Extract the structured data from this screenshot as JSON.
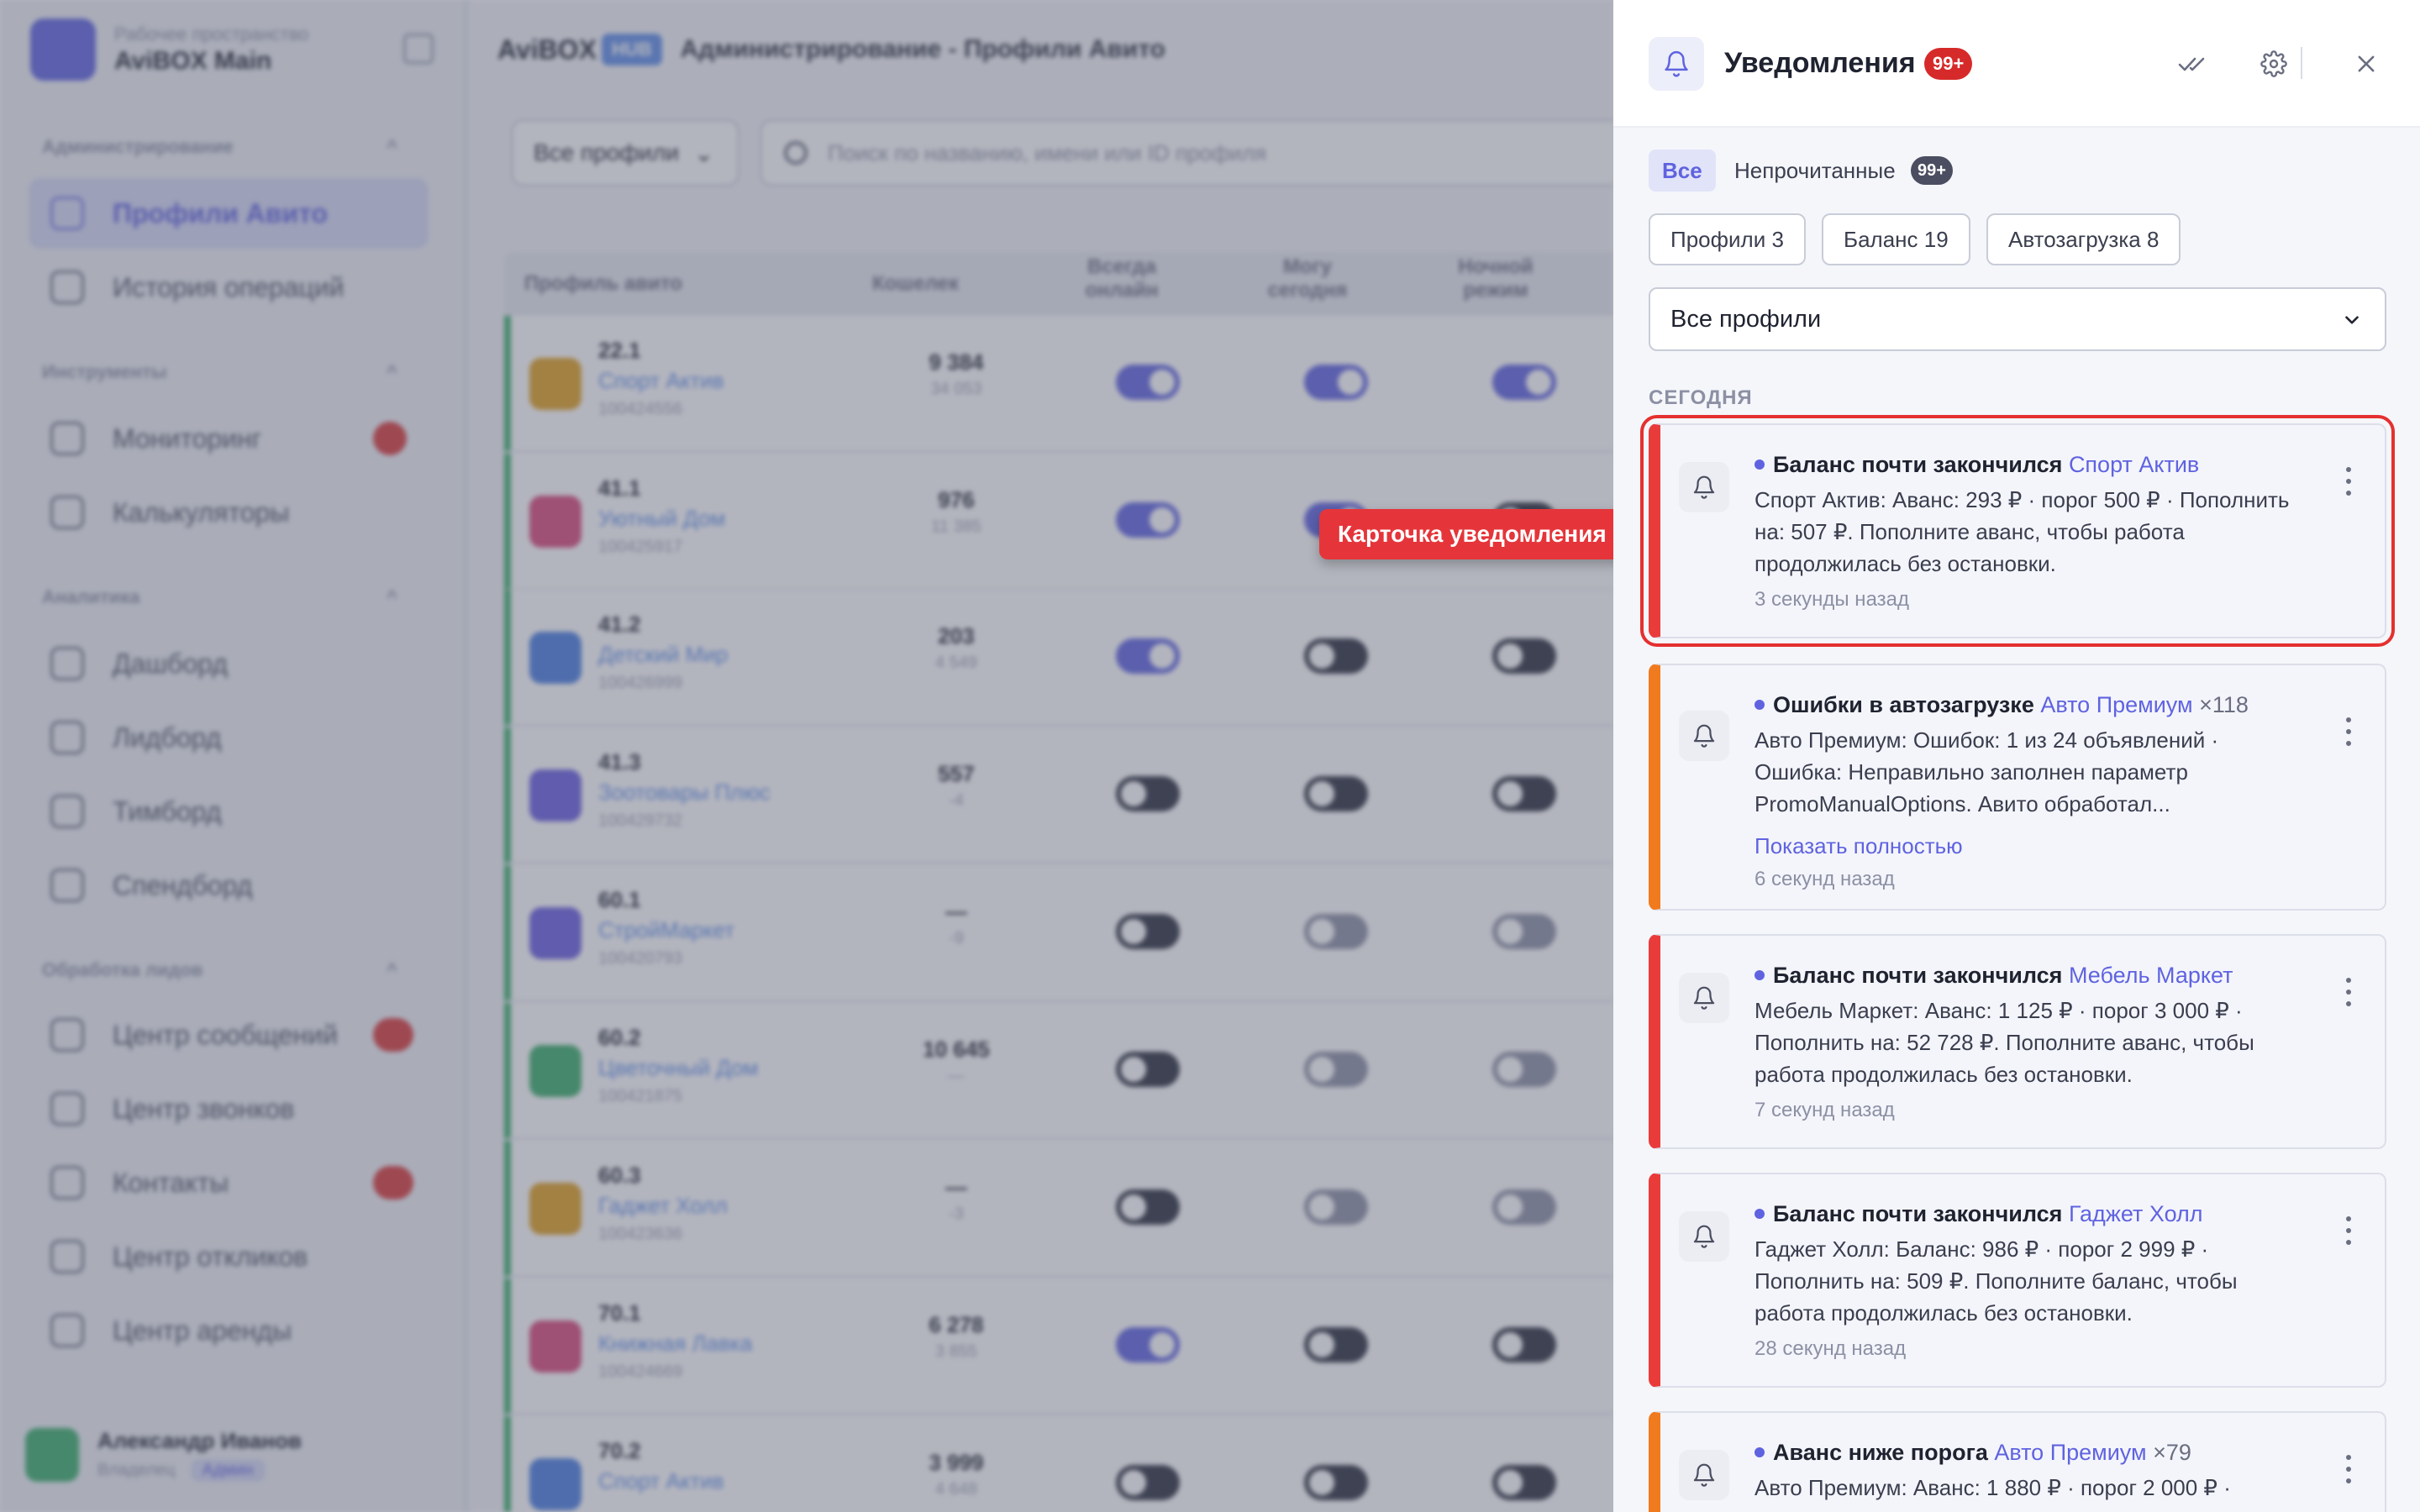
{
  "workspace": {
    "subtitle": "Рабочее пространство",
    "name": "AviBOX Main"
  },
  "sidebar": {
    "sections": [
      {
        "title": "Администрирование"
      },
      {
        "title": "Инструменты"
      },
      {
        "title": "Аналитика"
      },
      {
        "title": "Обработка лидов"
      }
    ],
    "items": [
      {
        "label": "Профили Авито",
        "icon": "users-icon"
      },
      {
        "label": "История операций",
        "icon": "history-icon"
      },
      {
        "label": "Мониторинг",
        "icon": "activity-icon"
      },
      {
        "label": "Калькуляторы",
        "icon": "calculator-icon"
      },
      {
        "label": "Дашборд",
        "icon": "grid-icon"
      },
      {
        "label": "Лидборд",
        "icon": "chart-icon"
      },
      {
        "label": "Тимборд",
        "icon": "headphones-icon"
      },
      {
        "label": "Спендборд",
        "icon": "wallet-icon"
      },
      {
        "label": "Центр сообщений",
        "icon": "messages-icon"
      },
      {
        "label": "Центр звонков",
        "icon": "phone-icon"
      },
      {
        "label": "Контакты",
        "icon": "contacts-icon"
      },
      {
        "label": "Центр откликов",
        "icon": "user-check-icon"
      },
      {
        "label": "Центр аренды",
        "icon": "refresh-icon"
      }
    ],
    "user": {
      "name": "Александр Иванов",
      "role": "Владелец",
      "badge": "Админ"
    }
  },
  "main": {
    "brand": "AviBOX",
    "brand_hub": "HUB",
    "title": "Администрирование - Профили Авито",
    "filter": "Все профили",
    "search_placeholder": "Поиск по названию, имени или ID профиля",
    "columns": [
      "Профиль авито",
      "Кошелек",
      "Всегда онлайн",
      "Могу сегодня",
      "Ночной режим"
    ],
    "rows": [
      {
        "num": "22.1",
        "name": "Спорт Актив",
        "id": "100424556",
        "wallet": "9 384",
        "wallet2": "34 053",
        "t1": "on",
        "t2": "on",
        "t3": "on",
        "color": "#e0a020"
      },
      {
        "num": "41.1",
        "name": "Уютный Дом",
        "id": "100425917",
        "wallet": "976",
        "wallet2": "11 385",
        "t1": "on",
        "t2": "on",
        "t3": "off",
        "color": "#d9487a"
      },
      {
        "num": "41.2",
        "name": "Детский Мир",
        "id": "100426999",
        "wallet": "203",
        "wallet2": "4 549",
        "t1": "on",
        "t2": "off",
        "t3": "off",
        "color": "#4a7de0"
      },
      {
        "num": "41.3",
        "name": "Зоотовары Плюс",
        "id": "100429732",
        "wallet": "557",
        "wallet2": "-4",
        "t1": "off",
        "t2": "off",
        "t3": "off",
        "color": "#6a5ee0"
      },
      {
        "num": "60.1",
        "name": "СтройМаркет",
        "id": "100420793",
        "wallet": "—",
        "wallet2": "-9",
        "t1": "off",
        "t2": "off-light",
        "t3": "off-light",
        "color": "#6a5ee0"
      },
      {
        "num": "60.2",
        "name": "Цветочный Дом",
        "id": "100421875",
        "wallet": "10 645",
        "wallet2": "—",
        "t1": "off",
        "t2": "off-light",
        "t3": "off-light",
        "color": "#3aae6a"
      },
      {
        "num": "60.3",
        "name": "Гаджет Холл",
        "id": "100423636",
        "wallet": "—",
        "wallet2": "-3",
        "t1": "off",
        "t2": "off-light",
        "t3": "off-light",
        "color": "#e0a020"
      },
      {
        "num": "70.1",
        "name": "Книжная Лавка",
        "id": "100424669",
        "wallet": "6 278",
        "wallet2": "3 855",
        "t1": "on",
        "t2": "off",
        "t3": "off",
        "color": "#d9487a"
      },
      {
        "num": "70.2",
        "name": "Спорт Актив",
        "id": "",
        "wallet": "3 999",
        "wallet2": "4 648",
        "t1": "off",
        "t2": "off",
        "t3": "off",
        "color": "#4a7de0"
      }
    ]
  },
  "notifications": {
    "title": "Уведомления",
    "count_badge": "99+",
    "tabs": {
      "all": "Все",
      "unread": "Непрочитанные",
      "unread_badge": "99+"
    },
    "chips": [
      "Профили 3",
      "Баланс 19",
      "Автозагрузка 8"
    ],
    "profile_filter": "Все профили",
    "group_label": "СЕГОДНЯ",
    "callout": "Карточка уведомления",
    "cards": [
      {
        "title": "Баланс почти закончился",
        "profile": "Спорт Актив",
        "count": "",
        "text": "Спорт Актив: Аванс: 293 ₽ · порог 500 ₽ · Пополнить на: 507 ₽. Пополните аванс, чтобы работа продолжилась без остановки.",
        "more": "",
        "time": "3 секунды назад",
        "accent": "#ea3b3b"
      },
      {
        "title": "Ошибки в автозагрузке",
        "profile": "Авто Премиум",
        "count": "×118",
        "text": "Авто Премиум: Ошибок: 1 из 24 объявлений · Ошибка: Неправильно заполнен параметр PromoManualOptions. Авито обработал...",
        "more": "Показать полностью",
        "time": "6 секунд назад",
        "accent": "#f07a1e"
      },
      {
        "title": "Баланс почти закончился",
        "profile": "Мебель Маркет",
        "count": "",
        "text": "Мебель Маркет: Аванс: 1 125 ₽ · порог 3 000 ₽ · Пополнить на: 52 728 ₽. Пополните аванс, чтобы работа продолжилась без остановки.",
        "more": "",
        "time": "7 секунд назад",
        "accent": "#ea3b3b"
      },
      {
        "title": "Баланс почти закончился",
        "profile": "Гаджет Холл",
        "count": "",
        "text": "Гаджет Холл: Баланс: 986 ₽ · порог 2 999 ₽ · Пополнить на: 509 ₽. Пополните баланс, чтобы работа продолжилась без остановки.",
        "more": "",
        "time": "28 секунд назад",
        "accent": "#ea3b3b"
      },
      {
        "title": "Аванс ниже порога",
        "profile": "Авто Премиум",
        "count": "×79",
        "text": "Авто Премиум: Аванс: 1 880 ₽ · порог 2 000 ₽ ·",
        "more": "",
        "time": "",
        "accent": "#f07a1e"
      }
    ]
  }
}
